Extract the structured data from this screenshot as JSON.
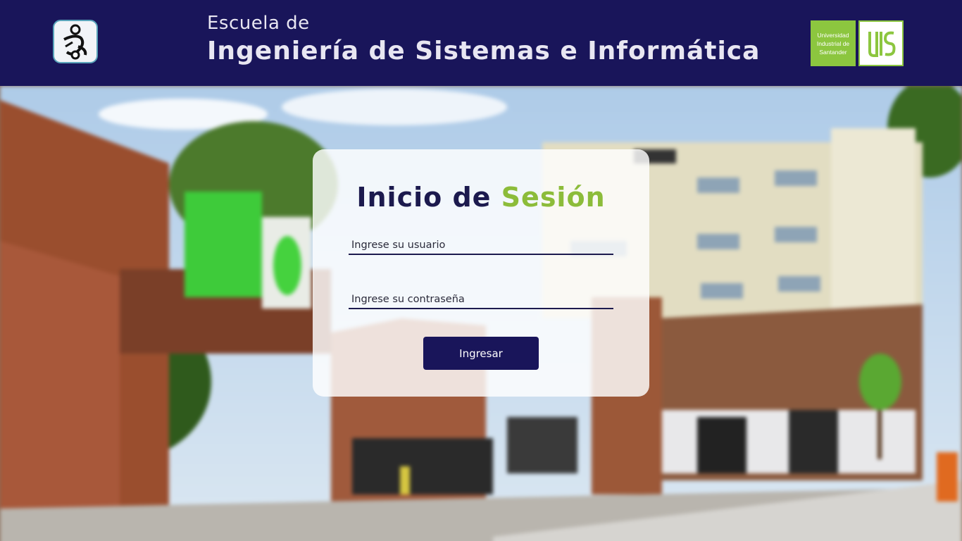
{
  "header": {
    "subtitle": "Escuela de",
    "title": "Ingeniería de Sistemas e Informática",
    "left_logo": "eisi-logo",
    "right_logo": {
      "name": "uis-logo",
      "text": "Universidad Industrial de Santander"
    }
  },
  "login": {
    "title_main": "Inicio de",
    "title_accent": "Sesión",
    "username_placeholder": "Ingrese su usuario",
    "password_placeholder": "Ingrese su contraseña",
    "submit_label": "Ingresar"
  },
  "colors": {
    "header_bg": "#19155a",
    "accent_green": "#8cbc3a",
    "button_bg": "#19155a"
  }
}
